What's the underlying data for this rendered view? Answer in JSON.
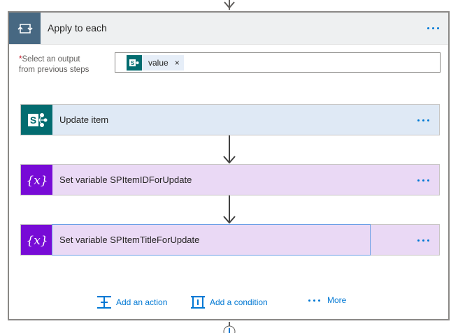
{
  "scope": {
    "title": "Apply to each",
    "select_label_required": "*",
    "select_label_line1": "Select an output",
    "select_label_line2": "from previous steps",
    "token": {
      "text": "value",
      "remove": "×"
    }
  },
  "steps": [
    {
      "title": "Update item",
      "kind": "sharepoint"
    },
    {
      "title": "Set variable SPItemIDForUpdate",
      "kind": "variable",
      "icon_text": "{x}"
    },
    {
      "title": "Set variable SPItemTitleForUpdate",
      "kind": "variable",
      "icon_text": "{x}"
    }
  ],
  "footer": {
    "add_action": "Add an action",
    "add_condition": "Add a condition",
    "more": "More"
  },
  "colors": {
    "accent": "#0078d4",
    "scope_icon": "#476882",
    "sharepoint": "#036c70",
    "variable": "#770bd6"
  }
}
